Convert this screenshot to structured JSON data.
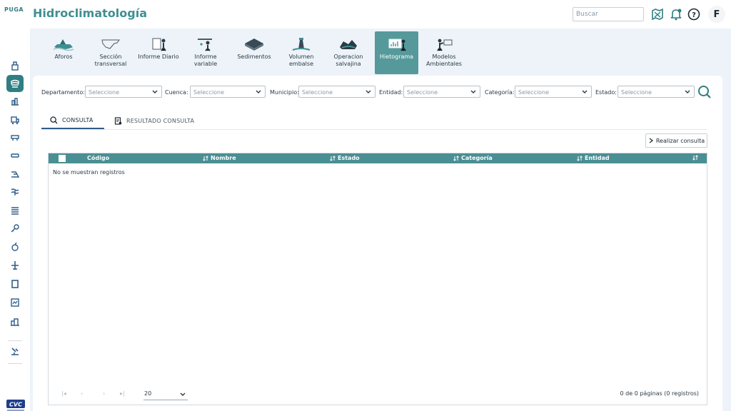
{
  "header": {
    "logo_text": "PUGA",
    "title": "Hidroclimatología",
    "search_placeholder": "Buscar",
    "avatar_initial": "F",
    "icons": [
      "map-settings-icon",
      "bell-icon",
      "help-icon"
    ]
  },
  "sidebar": {
    "items": [
      {
        "icon": "water-tower-icon"
      },
      {
        "icon": "dam-icon",
        "active": true
      },
      {
        "icon": "chart-building-icon"
      },
      {
        "icon": "truck-icon"
      },
      {
        "icon": "bridge-icon"
      },
      {
        "icon": "channel-icon"
      },
      {
        "icon": "slope-icon"
      },
      {
        "icon": "water-waves-icon"
      },
      {
        "icon": "layers-icon"
      },
      {
        "icon": "key-icon"
      },
      {
        "icon": "tree-icon"
      },
      {
        "icon": "airplane-icon"
      },
      {
        "icon": "book-icon"
      },
      {
        "icon": "document-chart-icon"
      },
      {
        "icon": "buildings-icon"
      },
      {
        "icon": "drill-icon"
      }
    ],
    "bottom_logo": "CVC"
  },
  "toolbar": {
    "tools": [
      {
        "label": "Aforos",
        "icon": "boat-icon"
      },
      {
        "label": "Sección transversal",
        "icon": "cross-section-icon"
      },
      {
        "label": "Informe Diario",
        "icon": "daily-report-icon"
      },
      {
        "label": "Informe variable",
        "icon": "variable-report-icon"
      },
      {
        "label": "Sedimentos",
        "icon": "sediment-icon"
      },
      {
        "label": "Volumen embalse",
        "icon": "lighthouse-icon"
      },
      {
        "label": "Operacion salvajina",
        "icon": "reservoir-icon"
      },
      {
        "label": "Hietograma",
        "icon": "hyetograph-icon",
        "active": true
      },
      {
        "label": "Modelos Ambientales",
        "icon": "environmental-models-icon"
      }
    ]
  },
  "filters": {
    "departamento": {
      "label": "Departamento:",
      "value": "Seleccione"
    },
    "cuenca": {
      "label": "Cuenca:",
      "value": "Seleccione"
    },
    "municipio": {
      "label": "Municipio:",
      "value": "Seleccione"
    },
    "entidad": {
      "label": "Entidad:",
      "value": "Seleccione"
    },
    "categoria": {
      "label": "Categoría:",
      "value": "Seleccione"
    },
    "estado": {
      "label": "Estado:",
      "value": "Seleccione"
    }
  },
  "tabs": [
    {
      "label": "CONSULTA",
      "icon": "search-icon",
      "active": true
    },
    {
      "label": "RESULTADO CONSULTA",
      "icon": "report-icon"
    }
  ],
  "actions": {
    "realizar_consulta": "Realizar consulta"
  },
  "grid": {
    "columns": [
      "Código",
      "Nombre",
      "Estado",
      "Categoría",
      "Entidad"
    ],
    "empty_message": "No se muestran registros",
    "page_size": "20",
    "pagination_info": "0 de 0 páginas (0 registros)"
  },
  "colors": {
    "accent": "#2f7e82",
    "header": "#4a8f93",
    "active_tool": "#56999b",
    "background": "#edf3f9"
  }
}
